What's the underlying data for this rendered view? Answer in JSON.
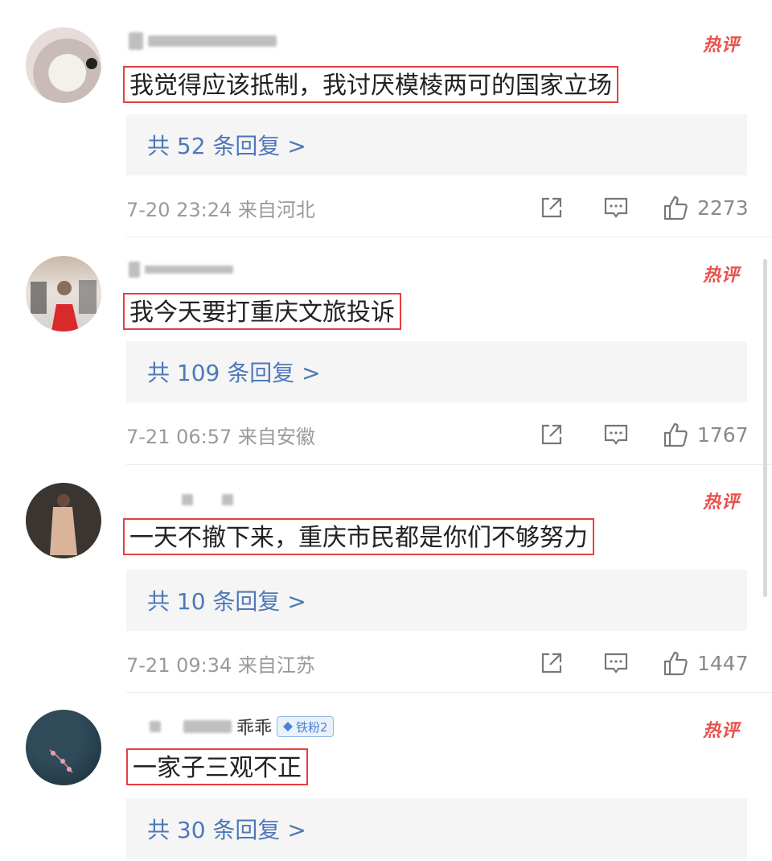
{
  "comments": [
    {
      "hot_tag": "热评",
      "text": "我觉得应该抵制，我讨厌模棱两可的国家立场",
      "reply_label": "共 52 条回复 >",
      "meta": "7-20 23:24 来自河北",
      "likes": "2273",
      "avatar_color": "#e6dcd9"
    },
    {
      "hot_tag": "热评",
      "text": "我今天要打重庆文旅投诉",
      "reply_label": "共 109 条回复 >",
      "meta": "7-21 06:57 来自安徽",
      "likes": "1767",
      "avatar_color": "#d8d2cc"
    },
    {
      "hot_tag": "热评",
      "text": "一天不撤下来，重庆市民都是你们不够努力",
      "reply_label": "共 10 条回复 >",
      "meta": "7-21 09:34 来自江苏",
      "likes": "1447",
      "avatar_color": "#3a3531"
    },
    {
      "hot_tag": "热评",
      "text": "一家子三观不正",
      "reply_label": "共 30 条回复 >",
      "username_suffix": "乖乖",
      "fan_badge": "铁粉2",
      "avatar_color": "#243b47"
    }
  ],
  "icons": {
    "share": "share-icon",
    "comment": "comment-icon",
    "like": "like-icon",
    "fan_badge": "diamond-icon"
  },
  "colors": {
    "highlight_border": "#e63f3f",
    "hot_tag": "#e8504c",
    "reply_link": "#4f78b8",
    "meta_text": "#9a9a9a"
  }
}
